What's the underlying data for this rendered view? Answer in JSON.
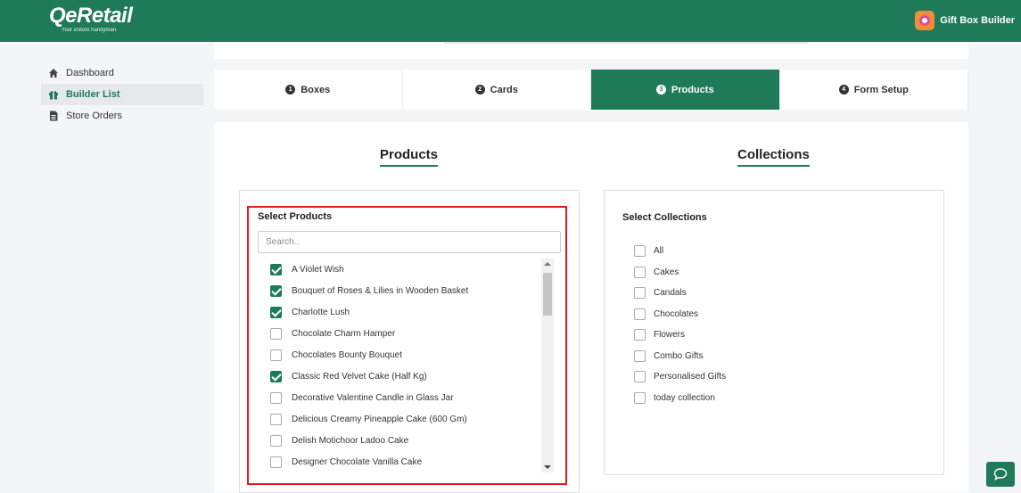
{
  "header": {
    "logo_text": "QeRetail",
    "logo_tagline": "Your eStore handyman",
    "app_name": "Gift Box Builder"
  },
  "sidebar": {
    "items": [
      {
        "label": "Dashboard",
        "icon": "home-icon",
        "active": false
      },
      {
        "label": "Builder List",
        "icon": "gift-icon",
        "active": true
      },
      {
        "label": "Store Orders",
        "icon": "document-icon",
        "active": false
      }
    ]
  },
  "tabs": [
    {
      "num": "1",
      "label": "Boxes",
      "active": false
    },
    {
      "num": "2",
      "label": "Cards",
      "active": false
    },
    {
      "num": "3",
      "label": "Products",
      "active": true
    },
    {
      "num": "4",
      "label": "Form Setup",
      "active": false
    }
  ],
  "products": {
    "heading": "Products",
    "select_title": "Select Products",
    "search_placeholder": "Search..",
    "items": [
      {
        "label": "A Violet Wish",
        "checked": true
      },
      {
        "label": "Bouquet of Roses & Lilies in Wooden Basket",
        "checked": true
      },
      {
        "label": "Charlotte Lush",
        "checked": true
      },
      {
        "label": "Chocolate Charm Hamper",
        "checked": false
      },
      {
        "label": "Chocolates Bounty Bouquet",
        "checked": false
      },
      {
        "label": "Classic Red Velvet Cake (Half Kg)",
        "checked": true
      },
      {
        "label": "Decorative Valentine Candle in Glass Jar",
        "checked": false
      },
      {
        "label": "Delicious Creamy Pineapple Cake (600 Gm)",
        "checked": false
      },
      {
        "label": "Delish Motichoor Ladoo Cake",
        "checked": false
      },
      {
        "label": "Designer Chocolate Vanilla Cake",
        "checked": false
      }
    ]
  },
  "collections": {
    "heading": "Collections",
    "select_title": "Select Collections",
    "items": [
      {
        "label": "All",
        "checked": false
      },
      {
        "label": "Cakes",
        "checked": false
      },
      {
        "label": "Candals",
        "checked": false
      },
      {
        "label": "Chocolates",
        "checked": false
      },
      {
        "label": "Flowers",
        "checked": false
      },
      {
        "label": "Combo Gifts",
        "checked": false
      },
      {
        "label": "Personalised Gifts",
        "checked": false
      },
      {
        "label": "today collection",
        "checked": false
      }
    ]
  },
  "colors": {
    "brand": "#1f7a5a",
    "highlight": "#e01b1b"
  }
}
